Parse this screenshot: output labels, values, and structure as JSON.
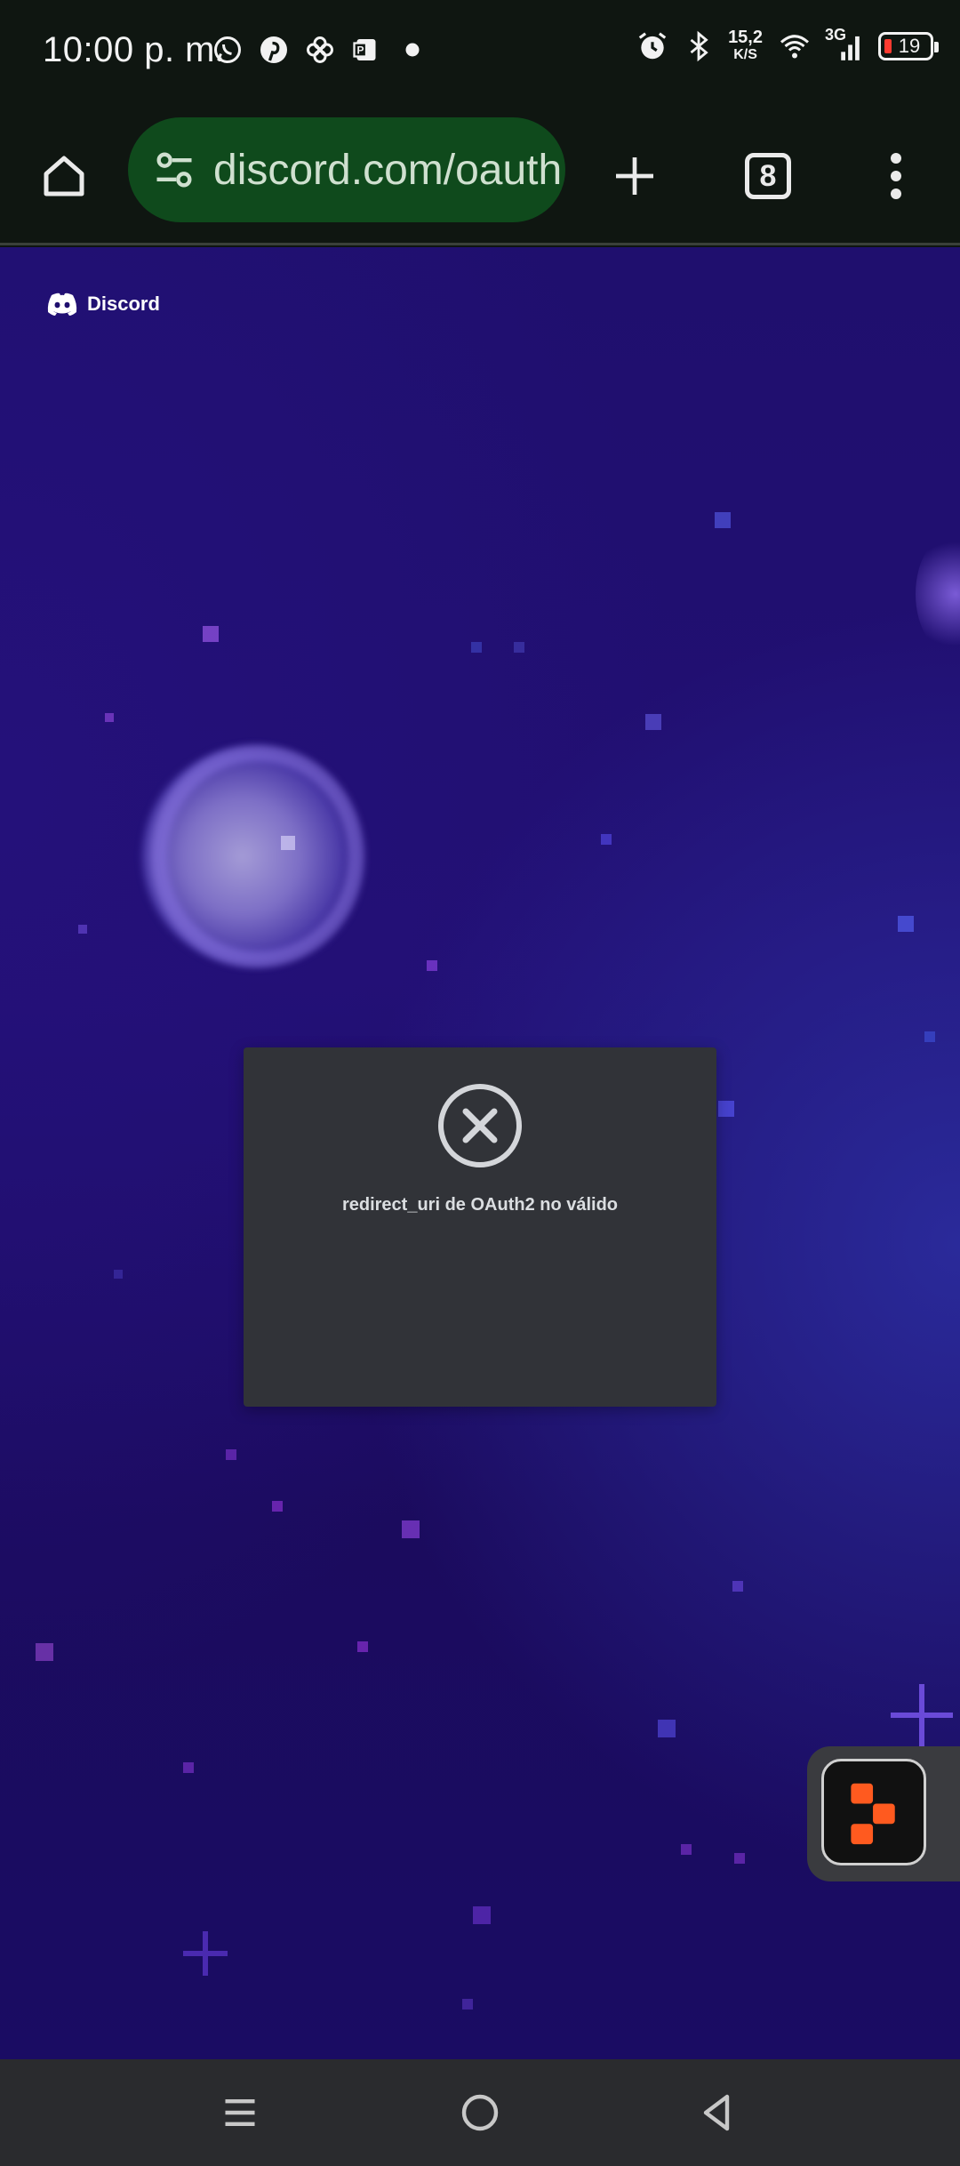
{
  "status_bar": {
    "time": "10:00 p. m.",
    "net_speed_value": "15,2",
    "net_speed_unit": "K/S",
    "network_type": "3G",
    "battery_level": "19",
    "notification_icons": [
      "whatsapp-icon",
      "pinterest-icon",
      "pinwheel-icon",
      "ppt-icon",
      "dot-icon"
    ],
    "system_icons": [
      "alarm-icon",
      "bluetooth-icon",
      "wifi-icon",
      "signal-icon",
      "battery-icon"
    ]
  },
  "browser": {
    "url": "discord.com/oauth",
    "tab_count": "8",
    "icons": [
      "home-icon",
      "site-settings-icon",
      "new-tab-icon",
      "tabs-icon",
      "more-menu-icon"
    ]
  },
  "page": {
    "brand_name": "Discord",
    "error_message": "redirect_uri de OAuth2 no válido",
    "colors": {
      "background_top": "#1f0f6e",
      "card": "#313338",
      "card_text": "#dbdee1",
      "url_bar": "#0f4a1c",
      "floating_accent": "#ff5a1f"
    }
  },
  "nav_bar": {
    "icons": [
      "recents-icon",
      "home-circle-icon",
      "back-icon"
    ]
  }
}
